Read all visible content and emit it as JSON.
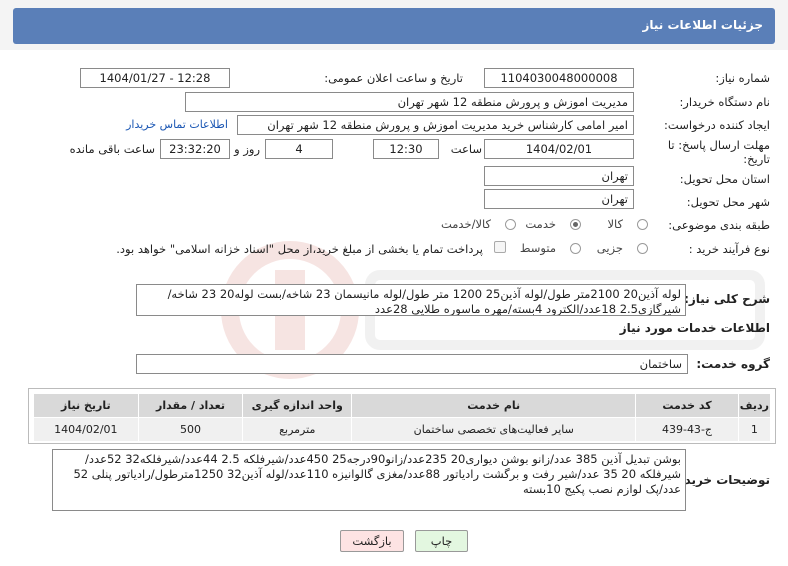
{
  "header": {
    "title": "جزئیات اطلاعات نیاز"
  },
  "form": {
    "need_number": {
      "label": "شماره نیاز:",
      "value": "1104030048000008"
    },
    "announce": {
      "label": "تاریخ و ساعت اعلان عمومی:",
      "value": "1404/01/27 - 12:28"
    },
    "buyer_org": {
      "label": "نام دستگاه خریدار:",
      "value": "مدیریت اموزش و پرورش منطقه 12 شهر تهران"
    },
    "creator": {
      "label": "ایجاد کننده درخواست:",
      "value": "امیر امامی کارشناس خرید مدیریت اموزش و پرورش منطقه 12 شهر تهران",
      "contact_link": "اطلاعات تماس خریدار"
    },
    "deadline": {
      "label_line1": "مهلت ارسال پاسخ: تا",
      "label_line2": "تاریخ:",
      "date": "1404/02/01",
      "time_label": "ساعت",
      "time": "12:30",
      "days": "4",
      "days_label": "روز و",
      "remaining": "23:32:20",
      "remaining_label": "ساعت باقی مانده"
    },
    "delivery_province": {
      "label": "استان محل تحویل:",
      "value": "تهران"
    },
    "delivery_city": {
      "label": "شهر محل تحویل:",
      "value": "تهران"
    },
    "category": {
      "label": "طبقه بندی موضوعی:",
      "options": [
        "کالا",
        "خدمت",
        "کالا/خدمت"
      ],
      "selected": "خدمت"
    },
    "process": {
      "label": "نوع فرآیند خرید :",
      "options": [
        "جزیی",
        "متوسط"
      ],
      "selected": "",
      "payment_note": "پرداخت تمام یا بخشی از مبلغ خرید،از محل \"اسناد خزانه اسلامی\" خواهد بود."
    }
  },
  "summary": {
    "label": "شرح کلی نیاز:",
    "text": "لوله آذین20 2100متر طول/لوله آذین25 1200 متر طول/لوله مانیسمان 23 شاخه/بست لوله20 23 شاخه/شیرگازی2.5 18عدد/الکترود 4بسته/مهره ماسوره طلایی 28عدد"
  },
  "services": {
    "section_title": "اطلاعات خدمات مورد نیاز",
    "group_label": "گروه خدمت:",
    "group_value": "ساختمان",
    "columns": [
      "ردیف",
      "کد خدمت",
      "نام خدمت",
      "واحد اندازه گیری",
      "تعداد / مقدار",
      "تاریخ نیاز"
    ],
    "rows": [
      {
        "row": "1",
        "code": "ج-43-439",
        "name": "سایر فعالیت‌های تخصصی ساختمان",
        "unit": "مترمربع",
        "qty": "500",
        "date": "1404/02/01"
      }
    ]
  },
  "buyer_notes": {
    "label": "توضیحات خریدار:",
    "text": "بوشن تبدیل آذین 385 عدد/زانو بوشن دیواری20 235عدد/زانو90درجه25 450عدد/شیرفلکه 2.5 44عدد/شیرفلکه32 52عدد/شیرفلکه 20 35 عدد/شیر رفت و برگشت رادیاتور 88عدد/مغزی گالوانیزه 110عدد/لوله آذین32 1250مترطول/رادیاتور پنلی 52 عدد/پک لوازم نصب پکیج 10بسته"
  },
  "actions": {
    "print": "چاپ",
    "back": "بازگشت"
  },
  "colors": {
    "title_bar": "#5a7fb8",
    "link": "#1a56b3",
    "back_button": "#fde3e3",
    "print_button": "#e3f7e0"
  }
}
